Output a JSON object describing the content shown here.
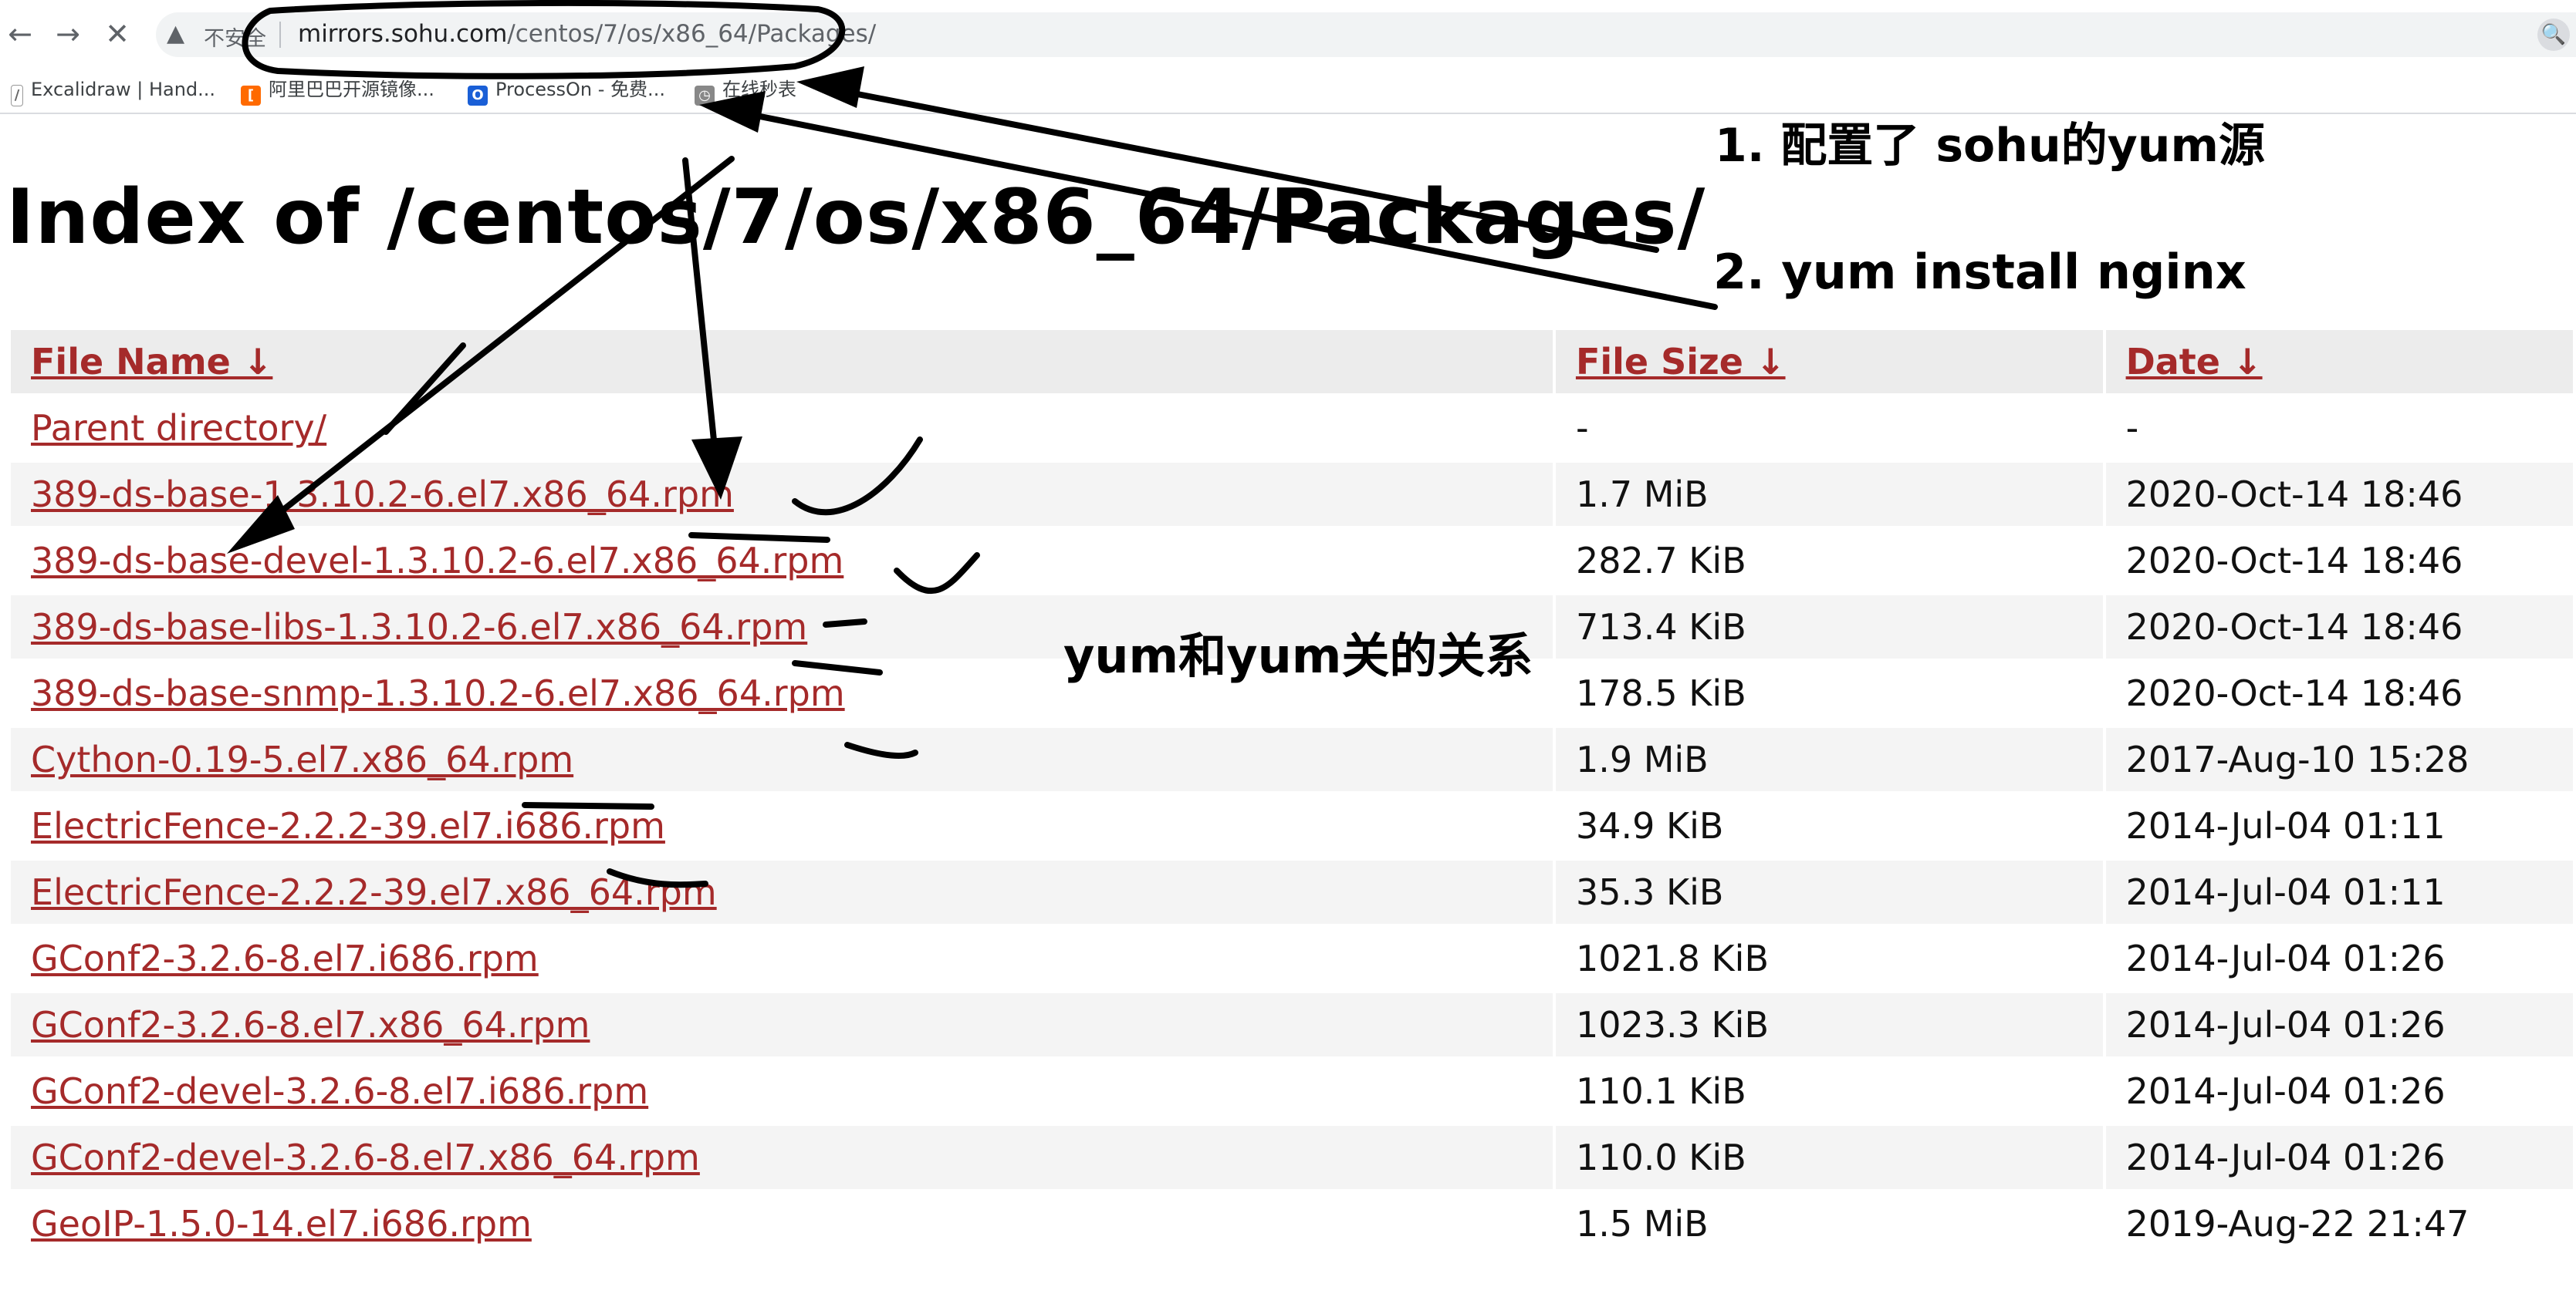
{
  "browser": {
    "back_icon": "←",
    "forward_icon": "→",
    "stop_icon": "✕",
    "warning_icon": "▲",
    "security_label": "不安全",
    "url_host": "mirrors.sohu.com",
    "url_path": "/centos/7/os/x86_64/Packages/",
    "lens_icon": "🔍",
    "bookmarks": [
      {
        "label": "Excalidraw | Hand...",
        "icon": "pen-icon"
      },
      {
        "label": "阿里巴巴开源镜像...",
        "icon": "aliyun-icon"
      },
      {
        "label": "ProcessOn - 免费...",
        "icon": "processon-icon"
      },
      {
        "label": "在线秒表",
        "icon": "stopwatch-icon"
      }
    ]
  },
  "page": {
    "title": "Index of /centos/7/os/x86_64/Packages/",
    "columns": {
      "name": "File Name ↓",
      "size": "File Size ↓",
      "date": "Date ↓"
    },
    "rows": [
      {
        "name": "Parent directory/",
        "size": "-",
        "date": "-"
      },
      {
        "name": "389-ds-base-1.3.10.2-6.el7.x86_64.rpm",
        "size": "1.7 MiB",
        "date": "2020-Oct-14 18:46"
      },
      {
        "name": "389-ds-base-devel-1.3.10.2-6.el7.x86_64.rpm",
        "size": "282.7 KiB",
        "date": "2020-Oct-14 18:46"
      },
      {
        "name": "389-ds-base-libs-1.3.10.2-6.el7.x86_64.rpm",
        "size": "713.4 KiB",
        "date": "2020-Oct-14 18:46"
      },
      {
        "name": "389-ds-base-snmp-1.3.10.2-6.el7.x86_64.rpm",
        "size": "178.5 KiB",
        "date": "2020-Oct-14 18:46"
      },
      {
        "name": "Cython-0.19-5.el7.x86_64.rpm",
        "size": "1.9 MiB",
        "date": "2017-Aug-10 15:28"
      },
      {
        "name": "ElectricFence-2.2.2-39.el7.i686.rpm",
        "size": "34.9 KiB",
        "date": "2014-Jul-04 01:11"
      },
      {
        "name": "ElectricFence-2.2.2-39.el7.x86_64.rpm",
        "size": "35.3 KiB",
        "date": "2014-Jul-04 01:11"
      },
      {
        "name": "GConf2-3.2.6-8.el7.i686.rpm",
        "size": "1021.8 KiB",
        "date": "2014-Jul-04 01:26"
      },
      {
        "name": "GConf2-3.2.6-8.el7.x86_64.rpm",
        "size": "1023.3 KiB",
        "date": "2014-Jul-04 01:26"
      },
      {
        "name": "GConf2-devel-3.2.6-8.el7.i686.rpm",
        "size": "110.1 KiB",
        "date": "2014-Jul-04 01:26"
      },
      {
        "name": "GConf2-devel-3.2.6-8.el7.x86_64.rpm",
        "size": "110.0 KiB",
        "date": "2014-Jul-04 01:26"
      },
      {
        "name": "GeoIP-1.5.0-14.el7.i686.rpm",
        "size": "1.5 MiB",
        "date": "2019-Aug-22 21:47"
      }
    ]
  },
  "annotations": {
    "step1": "1. 配置了 sohu的yum源",
    "step2": "2. yum install nginx",
    "relation": "yum和yum关的关系"
  },
  "colors": {
    "link": "#a52a2a",
    "header_bg": "#ececec",
    "stripe_bg": "#f4f4f4",
    "ink": "#000000"
  }
}
